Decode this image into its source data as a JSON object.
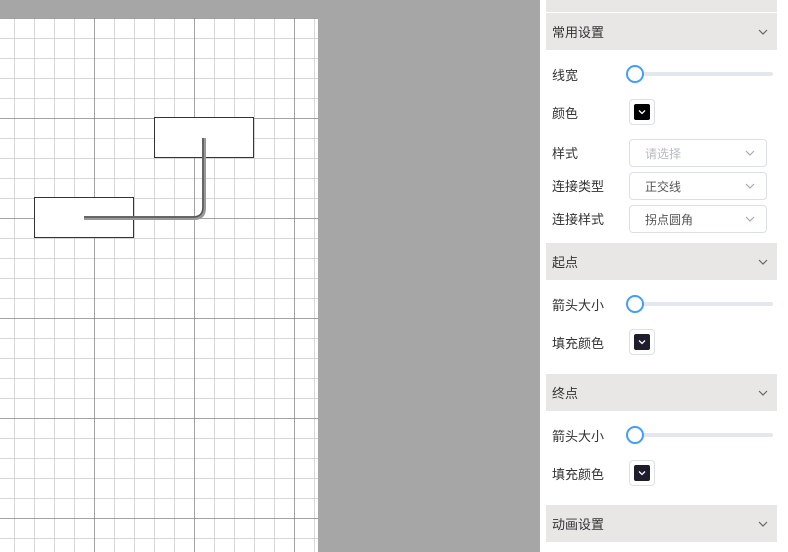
{
  "colors": {
    "canvas_bg": "#a6a6a6",
    "section_header_bg": "#e9e6e6",
    "slider_accent": "#409eff",
    "line_color": "#000000",
    "start_fill": "#1f1d2b",
    "end_fill": "#1f1d2b"
  },
  "canvas": {
    "nodes": [
      "rectangle-node",
      "rectangle-node"
    ],
    "edge_type": "orthogonal-rounded"
  },
  "sections": {
    "common": {
      "title": "常用设置",
      "line_width_label": "线宽",
      "line_width_value": 0,
      "color_label": "颜色",
      "style_label": "样式",
      "style_placeholder": "请选择",
      "connect_type_label": "连接类型",
      "connect_type_value": "正交线",
      "connect_style_label": "连接样式",
      "connect_style_value": "拐点圆角"
    },
    "start": {
      "title": "起点",
      "arrow_size_label": "箭头大小",
      "arrow_size_value": 0,
      "fill_color_label": "填充颜色"
    },
    "end": {
      "title": "终点",
      "arrow_size_label": "箭头大小",
      "arrow_size_value": 0,
      "fill_color_label": "填充颜色"
    },
    "animation": {
      "title": "动画设置"
    }
  },
  "icons": {
    "collapse": "chevron-down-icon",
    "color_dropdown": "chevron-down-icon"
  }
}
